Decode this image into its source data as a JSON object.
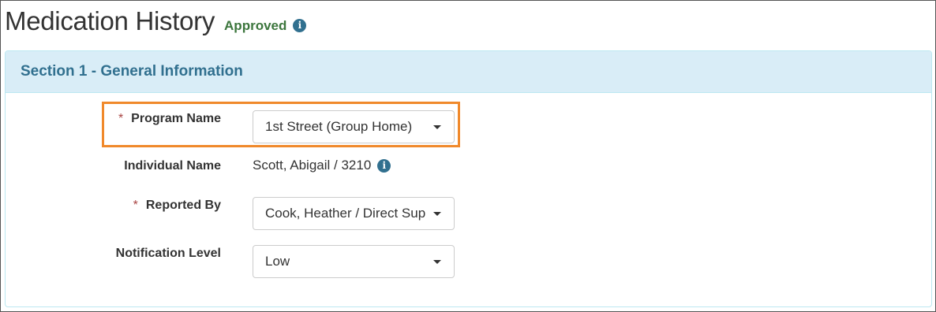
{
  "page": {
    "title": "Medication History",
    "status": "Approved",
    "status_color": "#3c763d",
    "info_icon": "info-circle-icon"
  },
  "section": {
    "title": "Section 1 - General Information",
    "fields": {
      "program_name": {
        "required_marker": "*",
        "label": "Program Name",
        "value": "1st Street (Group Home)"
      },
      "individual_name": {
        "label": "Individual Name",
        "value": "Scott, Abigail / 3210"
      },
      "reported_by": {
        "required_marker": "*",
        "label": "Reported By",
        "value": "Cook, Heather / Direct Sup"
      },
      "notification_level": {
        "label": "Notification Level",
        "value": "Low"
      }
    }
  },
  "colors": {
    "panel_heading_bg": "#d9edf7",
    "panel_title": "#31708f",
    "required": "#a94442",
    "highlight_border": "#f0892b"
  },
  "info_icon_glyph": "i"
}
